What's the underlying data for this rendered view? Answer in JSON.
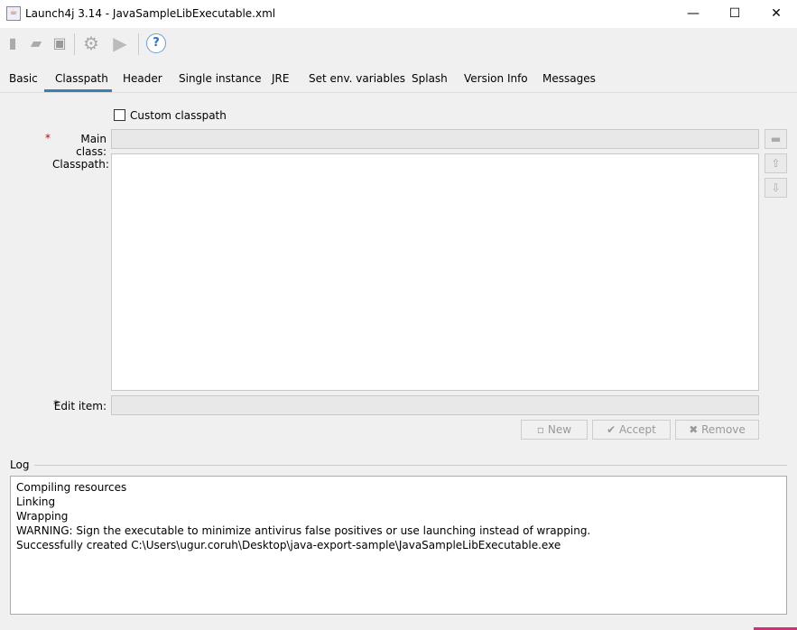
{
  "window": {
    "title": "Launch4j 3.14 - JavaSampleLibExecutable.xml",
    "minimize": "—",
    "maximize": "☐",
    "close": "✕"
  },
  "toolbar": {
    "icons": [
      "new-file-icon",
      "open-folder-icon",
      "save-icon",
      "settings-gear-icon",
      "run-icon",
      "help-icon"
    ]
  },
  "tabs": [
    {
      "label": "Basic"
    },
    {
      "label": "Classpath",
      "active": true
    },
    {
      "label": "Header"
    },
    {
      "label": "Single instance"
    },
    {
      "label": "JRE"
    },
    {
      "label": "Set env. variables"
    },
    {
      "label": "Splash"
    },
    {
      "label": "Version Info"
    },
    {
      "label": "Messages"
    }
  ],
  "classpath": {
    "custom_classpath_label": "Custom classpath",
    "custom_classpath_checked": false,
    "main_class_label": "Main class:",
    "classpath_label": "Classpath:",
    "edit_item_label": "Edit item:",
    "required_mark": "*",
    "main_class_value": "",
    "edit_item_value": ""
  },
  "buttons": {
    "new": "New",
    "accept": "Accept",
    "remove": "Remove"
  },
  "log": {
    "label": "Log",
    "lines": [
      "Compiling resources",
      "Linking",
      "Wrapping",
      "WARNING: Sign the executable to minimize antivirus false positives or use launching instead of wrapping.",
      "Successfully created C:\\Users\\ugur.coruh\\Desktop\\java-export-sample\\JavaSampleLibExecutable.exe"
    ]
  },
  "colors": {
    "accent": "#3c7fb1"
  }
}
